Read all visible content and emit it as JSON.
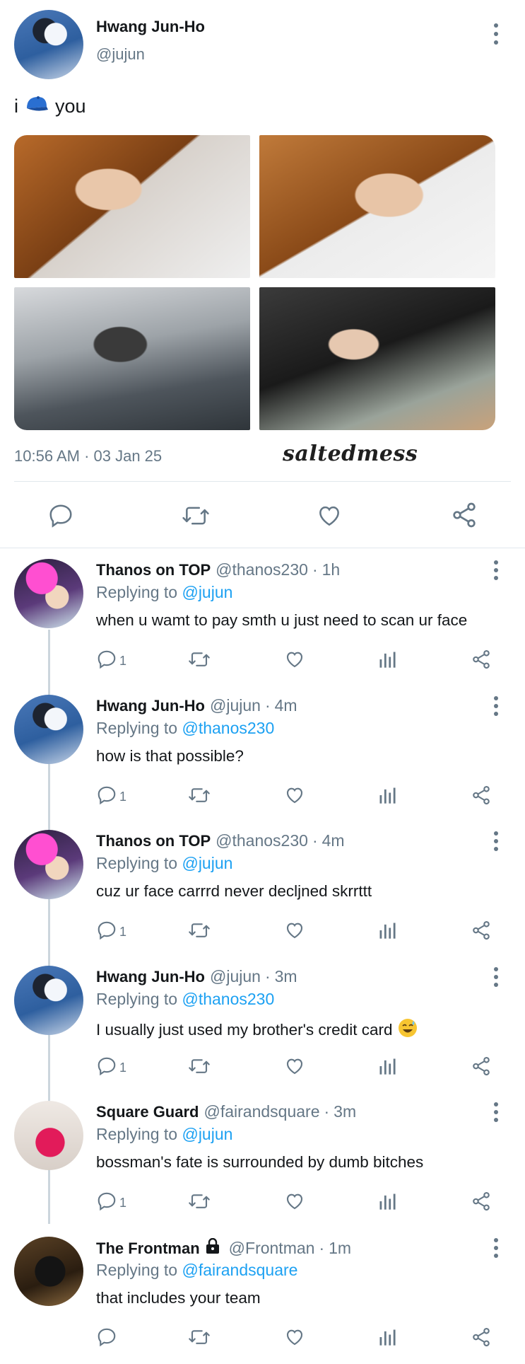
{
  "main_tweet": {
    "author_name": "Hwang Jun-Ho",
    "author_handle": "@jujun",
    "text_before": "i",
    "emoji": "blue-cap",
    "text_after": "you",
    "timestamp": "10:56 AM · 03 Jan 25",
    "watermark": "saltedmess",
    "photos": [
      "selfie-1",
      "selfie-2",
      "masked-at-cafe",
      "laughing-at-cafe"
    ]
  },
  "replies": [
    {
      "author_name": "Thanos on TOP",
      "author_handle": "@thanos230",
      "time": "1h",
      "replying_prefix": "Replying to",
      "replying_to": "@jujun",
      "text": "when u wamt to pay smth u just need to scan ur face",
      "reply_count": "1",
      "avatar": "thanos"
    },
    {
      "author_name": "Hwang Jun-Ho",
      "author_handle": "@jujun",
      "time": "4m",
      "replying_prefix": "Replying to",
      "replying_to": "@thanos230",
      "text": "how is that possible?",
      "reply_count": "1",
      "avatar": "jun"
    },
    {
      "author_name": "Thanos on TOP",
      "author_handle": "@thanos230",
      "time": "4m",
      "replying_prefix": "Replying to",
      "replying_to": "@jujun",
      "text": "cuz ur face carrrd never decljned skrrttt",
      "reply_count": "1",
      "avatar": "thanos"
    },
    {
      "author_name": "Hwang Jun-Ho",
      "author_handle": "@jujun",
      "time": "3m",
      "replying_prefix": "Replying to",
      "replying_to": "@thanos230",
      "text": "I usually just used my brother's credit card",
      "emoji": "grinning-sweat",
      "reply_count": "1",
      "avatar": "jun"
    },
    {
      "author_name": "Square Guard",
      "author_handle": "@fairandsquare",
      "time": "3m",
      "replying_prefix": "Replying to",
      "replying_to": "@jujun",
      "text": "bossman's fate is surrounded by dumb bitches",
      "reply_count": "1",
      "avatar": "guard"
    },
    {
      "author_name": "The Frontman",
      "author_handle": "@Frontman",
      "time": "1m",
      "replying_prefix": "Replying to",
      "replying_to": "@fairandsquare",
      "text": "that includes your team",
      "reply_count": "",
      "avatar": "front",
      "locked": true
    }
  ],
  "colors": {
    "text": "#14171a",
    "muted": "#657786",
    "link": "#1da1f2",
    "divider": "#e1e8ed"
  }
}
